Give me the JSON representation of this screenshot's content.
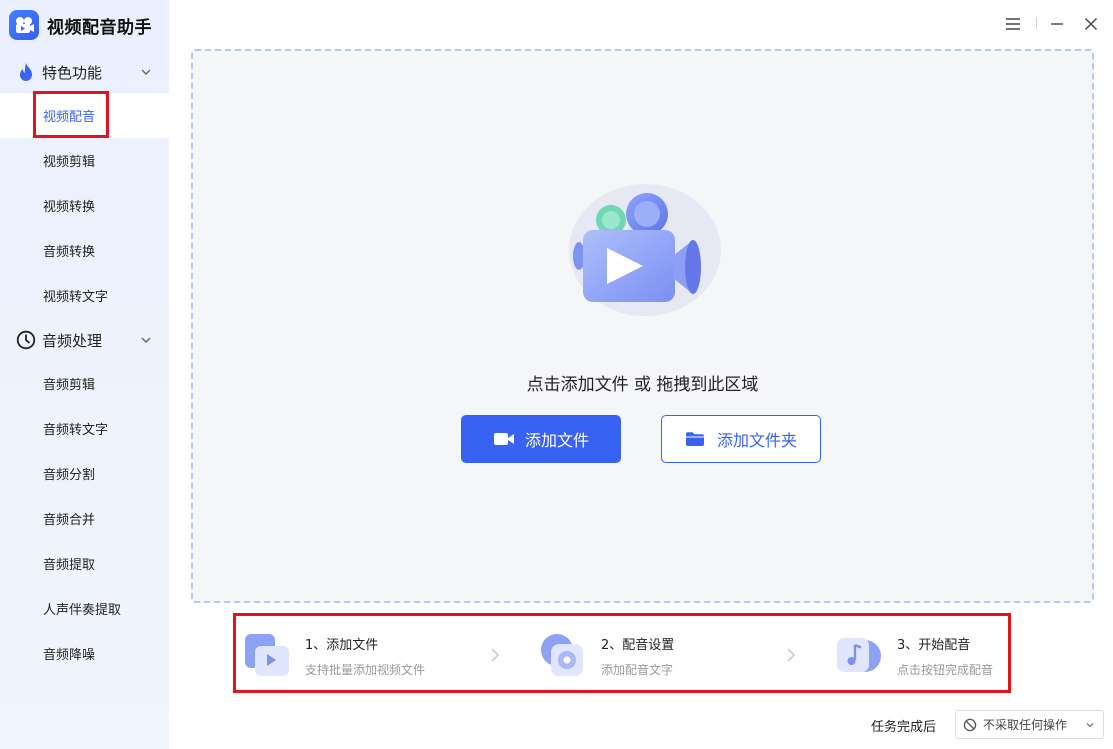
{
  "app": {
    "title": "视频配音助手"
  },
  "sidebar": {
    "groups": [
      {
        "label": "特色功能",
        "icon": "flame-icon",
        "items": [
          "视频配音",
          "视频剪辑",
          "视频转换",
          "音频转换",
          "视频转文字"
        ]
      },
      {
        "label": "音频处理",
        "icon": "timer-icon",
        "items": [
          "音频剪辑",
          "音频转文字",
          "音频分割",
          "音频合并",
          "音频提取",
          "人声伴奏提取",
          "音频降噪"
        ]
      }
    ],
    "active_item": "视频配音"
  },
  "window_controls": [
    "menu-icon",
    "minimize-icon",
    "close-icon"
  ],
  "dropzone": {
    "hint": "点击添加文件 或 拖拽到此区域",
    "add_file_label": "添加文件",
    "add_folder_label": "添加文件夹"
  },
  "steps": [
    {
      "title": "1、添加文件",
      "desc": "支持批量添加视频文件",
      "icon": "video-file-icon"
    },
    {
      "title": "2、配音设置",
      "desc": "添加配音文字",
      "icon": "disc-settings-icon"
    },
    {
      "title": "3、开始配音",
      "desc": "点击按钮完成配音",
      "icon": "music-note-icon"
    }
  ],
  "footer": {
    "after_task_label": "任务完成后",
    "after_task_value": "不采取任何操作"
  },
  "colors": {
    "accent": "#3863f2",
    "highlight": "#e0141a",
    "sidebar_bg": "#eaf0fd"
  }
}
